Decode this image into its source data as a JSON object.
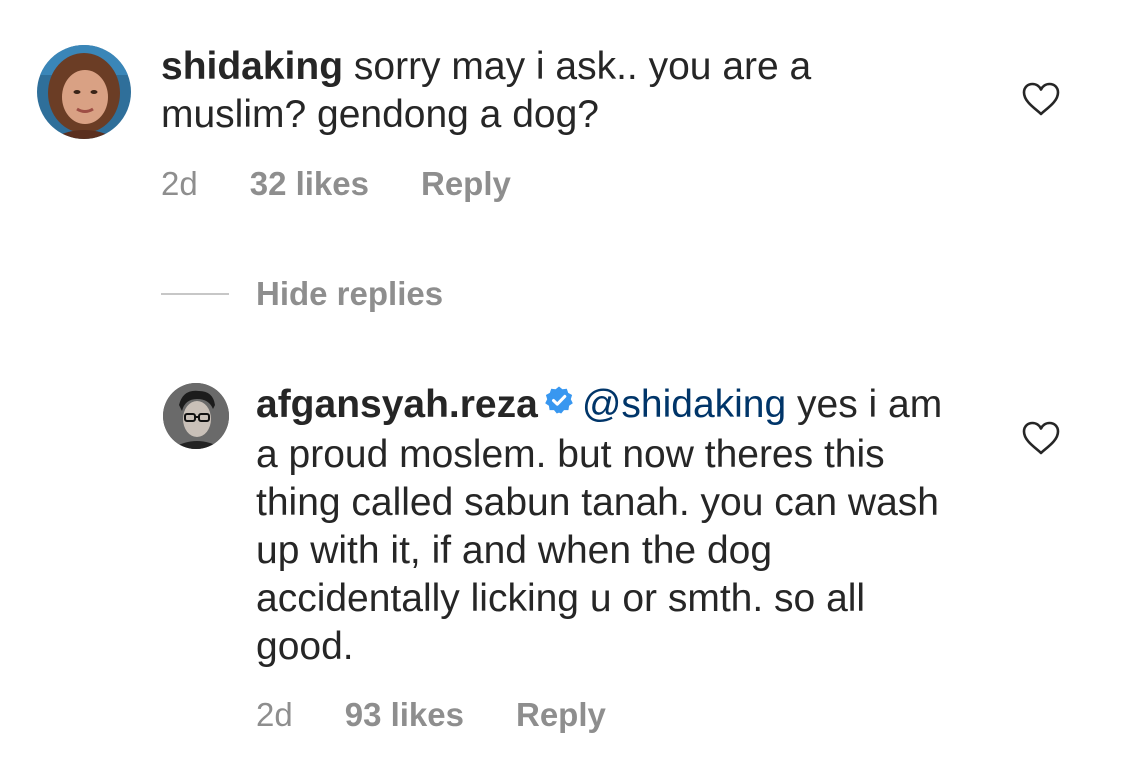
{
  "comment": {
    "username": "shidaking",
    "text": "sorry may i ask.. you are a muslim? gendong a dog?",
    "time": "2d",
    "likes": "32 likes",
    "reply_label": "Reply",
    "avatar_icon": "user-avatar-woman",
    "like_icon": "heart-outline-icon"
  },
  "thread": {
    "hide_replies_label": "Hide replies"
  },
  "reply": {
    "username": "afgansyah.reza",
    "verified_icon": "verified-badge-icon",
    "mention": "@shidaking",
    "text": "yes i am a proud moslem. but now theres this thing called sabun tanah. you can wash up with it, if and when the dog accidentally licking u or smth. so all good.",
    "time": "2d",
    "likes": "93 likes",
    "reply_label": "Reply",
    "avatar_icon": "user-avatar-man",
    "like_icon": "heart-outline-icon"
  },
  "colors": {
    "text": "#262626",
    "secondary": "#8e8e8e",
    "mention": "#003569",
    "verified": "#3897f0"
  }
}
